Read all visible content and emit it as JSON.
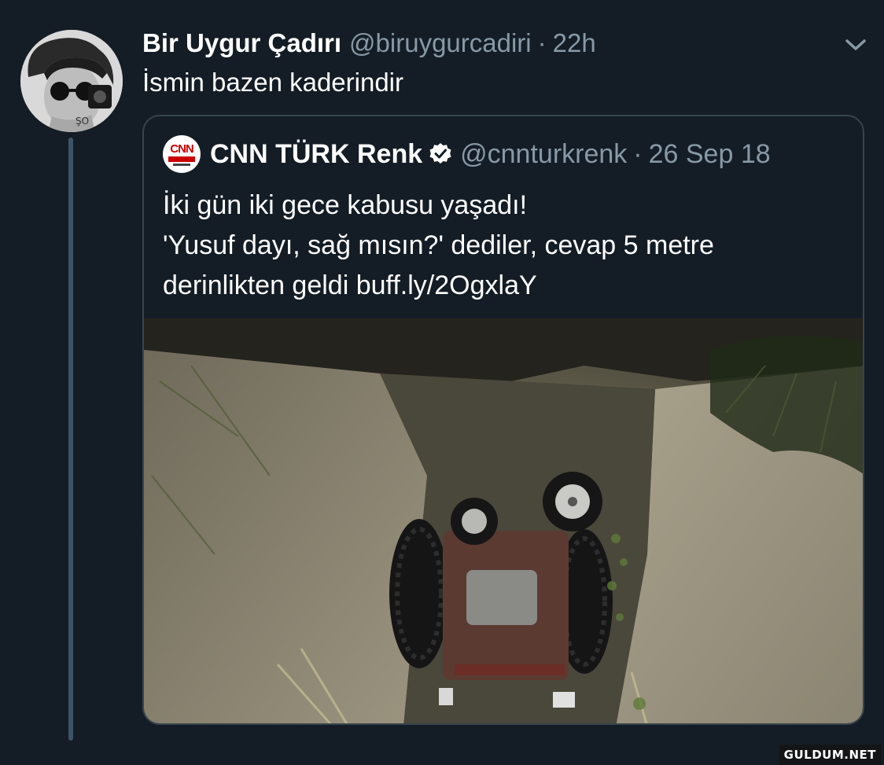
{
  "tweet": {
    "display_name": "Bir Uygur Çadırı",
    "handle": "@biruygurcadiri",
    "separator": "·",
    "time": "22h",
    "text": "İsmin bazen kaderindir"
  },
  "quoted_tweet": {
    "logo_text": "CNN",
    "display_name": "CNN TÜRK Renk",
    "verified": true,
    "handle": "@cnnturkrenk",
    "separator": "·",
    "date": "26 Sep 18",
    "text_lines": [
      "İki gün iki gece kabusu yaşadı!",
      "'Yusuf dayı, sağ mısın?' dediler, cevap 5 metre",
      "derinlikten geldi buff.ly/2OgxlaY"
    ]
  },
  "watermark": "GULDUM.NET",
  "colors": {
    "background": "#141d26",
    "secondary_text": "#8899a6",
    "border": "#38444d",
    "thread_line": "#3d5466",
    "verified_badge": "#ffffff"
  },
  "icons": {
    "menu": "chevron-down-icon",
    "verified": "verified-badge-icon"
  }
}
